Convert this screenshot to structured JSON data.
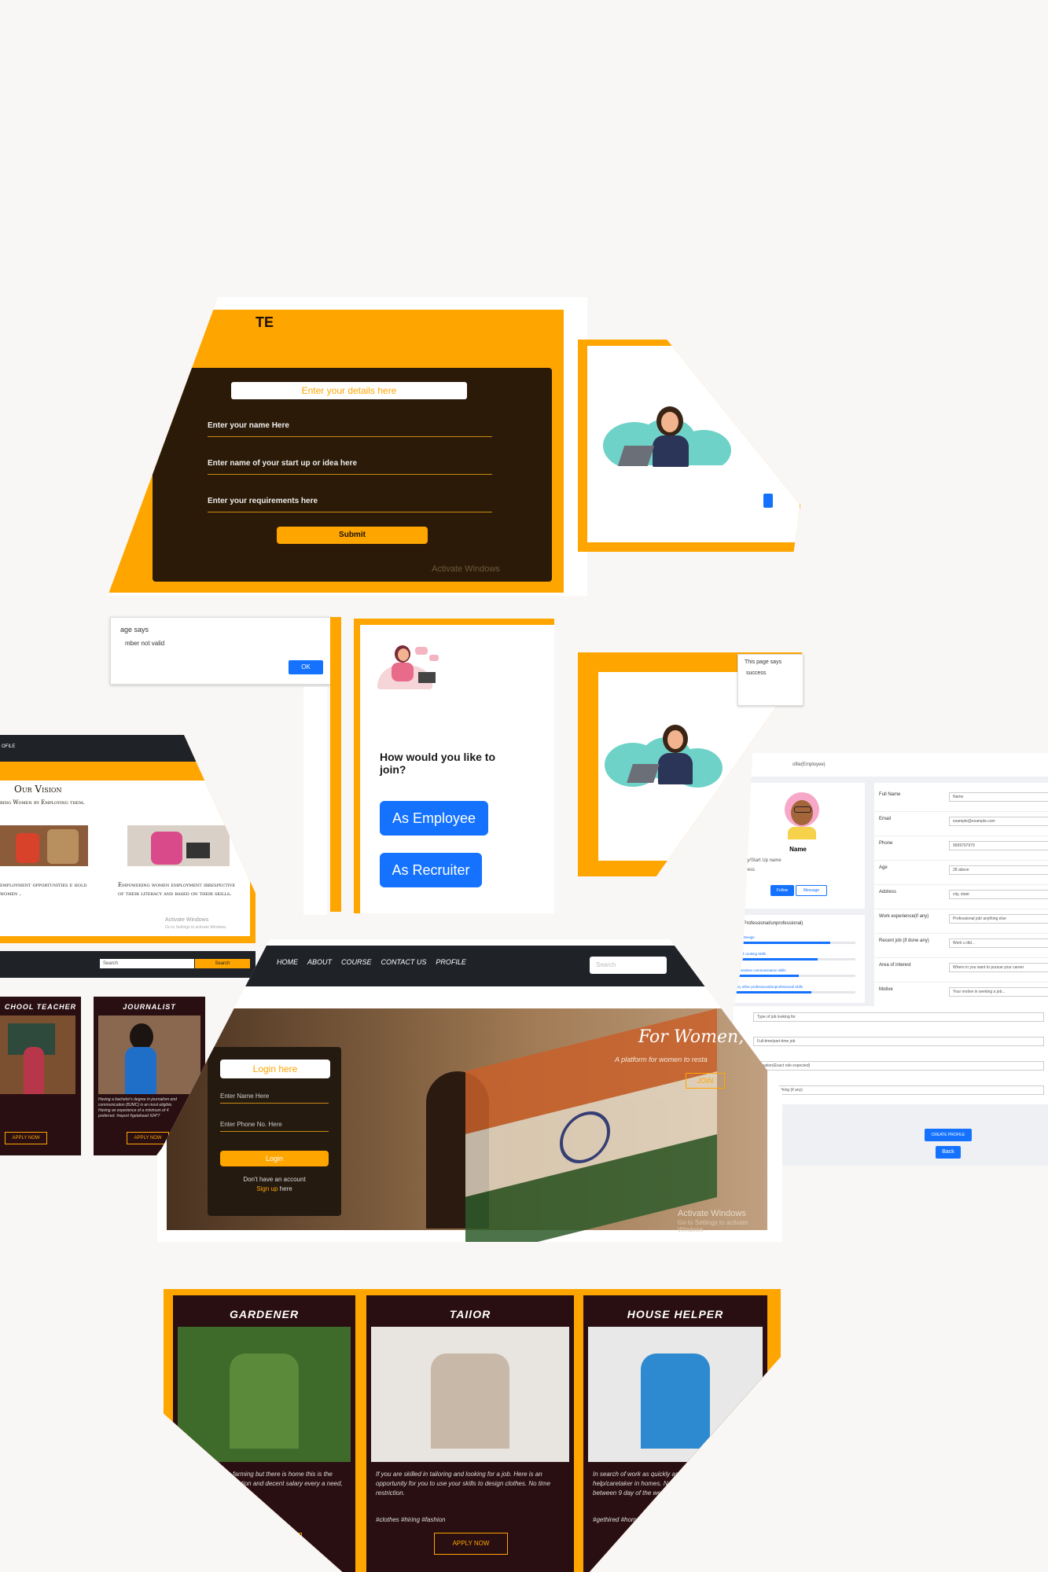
{
  "startup_form": {
    "title_fragment": "TE",
    "header_input": "Enter your details here",
    "fields": [
      "Enter your name Here",
      "Enter name of your start up or idea here",
      "Enter your requirements here"
    ],
    "submit": "Submit",
    "watermark": "Activate Windows"
  },
  "alert_invalid": {
    "title": "age says",
    "message": "mber not valid",
    "ok": "OK"
  },
  "vision": {
    "nav_text": "OFILE",
    "title": "Our Vision",
    "subtitle": "ring Women by Employing them.",
    "left_caption": "employment opportunities e hold women .",
    "right_caption": "Empowering women employment irrespective of their literacy and based on their skills.",
    "watermark_1": "Activate Windows",
    "watermark_2": "Go to Settings to activate Windows"
  },
  "join_choice": {
    "question": "How would you like to join?",
    "employee": "As Employee",
    "recruiter": "As Recruiter"
  },
  "alert_success": {
    "title": "This page says",
    "message": "success"
  },
  "profile": {
    "breadcrumb": "ofile(Employee)",
    "name": "Name",
    "company": "ompany/Start Up name",
    "address": "Address",
    "follow": "Follow",
    "message": "Message",
    "skills_title": "Skills (Professional/unprofessional)",
    "skills": [
      {
        "label": "ex: Web Design",
        "level": 0.8
      },
      {
        "label": "ex: Good cooking skills",
        "level": 0.7
      },
      {
        "label": "ex: Impressive communication skills",
        "level": 0.55
      },
      {
        "label": "ex: any other professional/unprofessional skills",
        "level": 0.65
      }
    ],
    "rows": [
      {
        "label": "Full Name",
        "value": "Name"
      },
      {
        "label": "Email",
        "value": "example@example.com"
      },
      {
        "label": "Phone",
        "value": "9699797979"
      },
      {
        "label": "Age",
        "value": "28 above"
      },
      {
        "label": "Address",
        "value": "city, state"
      },
      {
        "label": "Work experience(if any)",
        "value": "Professional job/ anything else"
      },
      {
        "label": "Recent job (if done any)",
        "value": "Work u did..."
      },
      {
        "label": "Area of interest",
        "value": "Where in you want to pursue your career"
      },
      {
        "label": "Motive",
        "value": "Your motive in seeking a job..."
      }
    ],
    "extra_fields": [
      "Type of job looking for",
      "Full-time/part-time job",
      "signation(Exact role expected)",
      "earning something (if any)"
    ],
    "create": "CREATE PROFILE",
    "back": "Back"
  },
  "search_bar": {
    "placeholder": "Search",
    "button": "Search"
  },
  "small_jobs": [
    {
      "title": "CHOOL TEACHER",
      "desc": "",
      "apply": "APPLY NOW"
    },
    {
      "title": "JOURNALIST",
      "desc": "Having a bachelor's degree in journalism and communication (BJMC) is an most eligible. Having an experience of a minimum of 4 preferred. #report #getahead #24*7",
      "apply": "APPLY NOW"
    }
  ],
  "home": {
    "nav": [
      "HOME",
      "ABOUT",
      "COURSE",
      "CONTACT US",
      "PROFILE"
    ],
    "search_placeholder": "Search",
    "hero_title": "For Women, B",
    "hero_sub": "A platform for women to resta",
    "join": "JOIN",
    "login_title": "Login here",
    "name_field": "Enter Name Here",
    "phone_field": "Enter Phone No. Here",
    "login_button": "Login",
    "no_account": "Don't have an account",
    "signup_link": "Sign up",
    "signup_here": "here",
    "watermark_1": "Activate Windows",
    "watermark_2": "Go to Settings to activate Windows"
  },
  "jobs": [
    {
      "title": "GARDENER",
      "desc": "dening or organic farming but there is home this is the best opportunity for ction and decent salary every a need, get going now.",
      "tags": "dynow #plants",
      "apply": "NOW"
    },
    {
      "title": "TAIlOR",
      "desc": "If you are skilled in tailoring and looking for a job. Here is an opportunity for you to use your skills to design clothes. No time restriction.",
      "tags": "#clothes #hiring #fashion",
      "apply": "APPLY NOW"
    },
    {
      "title": "HOUSE HELPER",
      "desc": "In search of work as quickly as possibl house help/caretaker in homes. No sl but should be available between 9 day of the week.",
      "tags": "#gethired #home #helpasho",
      "apply": "AP"
    }
  ],
  "colors": {
    "orange": "#ffa500",
    "brown": "#2b1a07",
    "blue": "#1472ff",
    "dark": "#1f2227",
    "card": "#2a0f12"
  }
}
